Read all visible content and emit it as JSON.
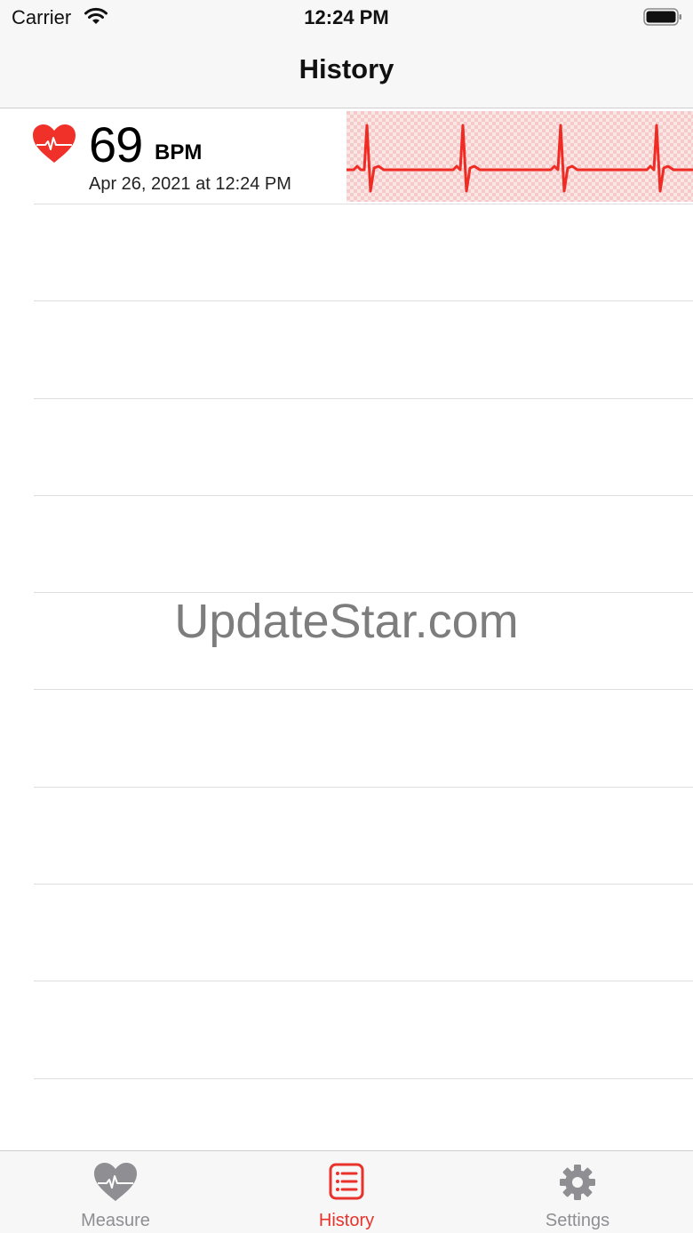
{
  "status_bar": {
    "carrier": "Carrier",
    "time": "12:24 PM"
  },
  "nav": {
    "title": "History"
  },
  "records": [
    {
      "bpm": "69",
      "unit": "BPM",
      "timestamp": "Apr 26, 2021 at 12:24 PM"
    }
  ],
  "watermark": "UpdateStar.com",
  "tabs": [
    {
      "label": "Measure",
      "icon": "heart-icon",
      "active": false
    },
    {
      "label": "History",
      "icon": "list-icon",
      "active": true
    },
    {
      "label": "Settings",
      "icon": "gear-icon",
      "active": false
    }
  ],
  "colors": {
    "accent": "#e8322b",
    "inactive": "#8e8e93",
    "bar_bg": "#f7f7f7"
  }
}
